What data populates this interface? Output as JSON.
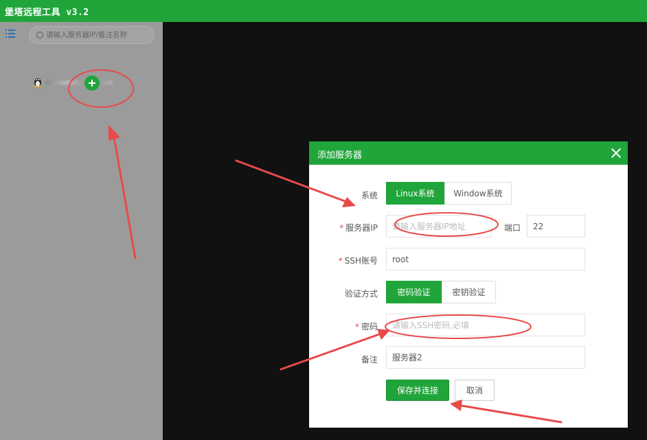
{
  "app": {
    "title": "堡塔远程工具 v3.2"
  },
  "sidebar": {
    "search_placeholder": "请输入服务器IP/备注名称",
    "servers": [
      {
        "os_icon": "linux-icon",
        "name_redacted": true
      }
    ],
    "add_button_icon": "plus-icon"
  },
  "dialog": {
    "title": "添加服务器",
    "close_icon": "close-icon",
    "system": {
      "label": "系统",
      "options": [
        "Linux系统",
        "Window系统"
      ],
      "selected": "Linux系统"
    },
    "server_ip": {
      "required_mark": "*",
      "label": "服务器IP",
      "placeholder": "请输入服务器IP地址",
      "value": ""
    },
    "port": {
      "label": "端口",
      "value": "22"
    },
    "ssh_account": {
      "required_mark": "*",
      "label": "SSH账号",
      "value": "root"
    },
    "auth_method": {
      "label": "验证方式",
      "options": [
        "密码验证",
        "密钥验证"
      ],
      "selected": "密码验证"
    },
    "password": {
      "required_mark": "*",
      "label": "密码",
      "placeholder": "请输入SSH密码,必填",
      "value": ""
    },
    "remark": {
      "label": "备注",
      "value": "服务器2"
    },
    "save_button": "保存并连接",
    "cancel_button": "取消"
  },
  "annotation_color": "#e84a4a",
  "theme": {
    "accent": "#20a53a",
    "sidebar_bg": "#9b9b9b",
    "background": "#111111"
  }
}
